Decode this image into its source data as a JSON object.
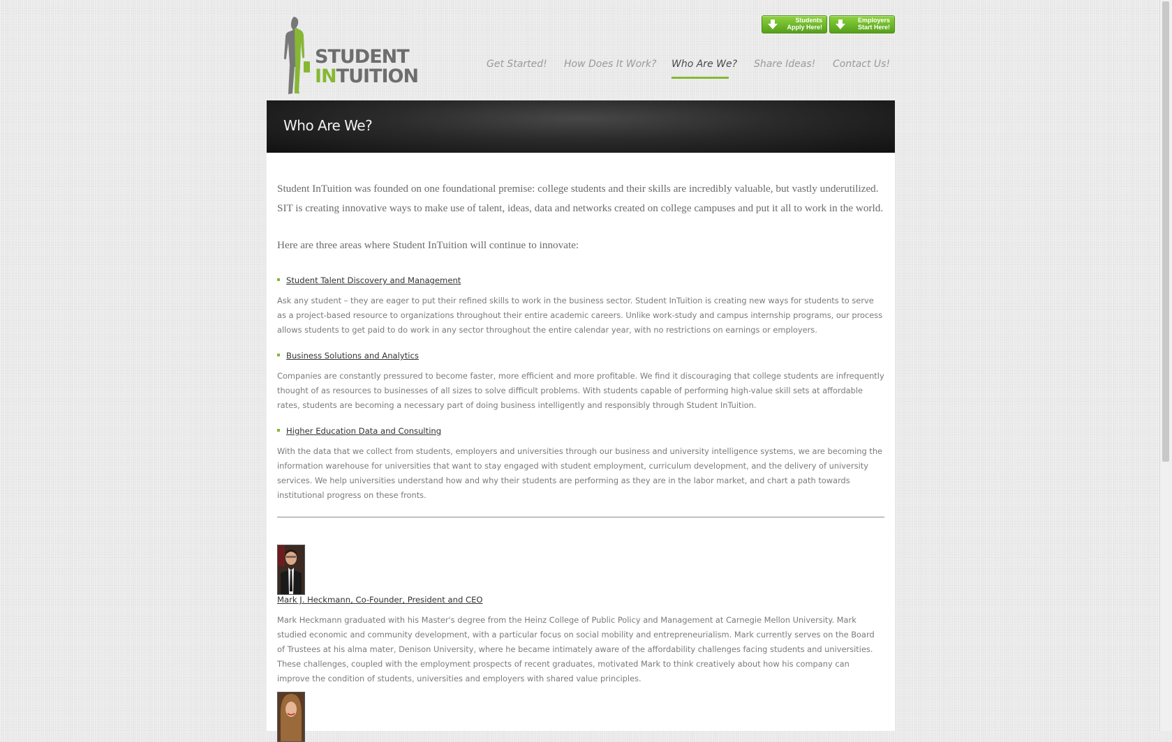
{
  "brand": {
    "wordmark_line1": "STUDENT",
    "wordmark_in": "IN",
    "wordmark_rest": "TUITION",
    "accent_color": "#86b834",
    "gray_color": "#6d6d6d"
  },
  "cta": {
    "students": {
      "line1": "Students",
      "line2": "Apply Here!",
      "icon": "down-arrow-icon"
    },
    "employers": {
      "line1": "Employers",
      "line2": "Start Here!",
      "icon": "down-arrow-icon"
    }
  },
  "nav": {
    "items": [
      {
        "label": "Get Started!"
      },
      {
        "label": "How Does It Work?"
      },
      {
        "label": "Who Are We?",
        "active": true
      },
      {
        "label": "Share Ideas!"
      },
      {
        "label": "Contact Us!"
      }
    ]
  },
  "page": {
    "title": "Who Are We?",
    "intro": "Student InTuition was founded on one foundational premise: college students and their skills are incredibly valuable, but vastly underutilized. SIT is creating innovative ways to make use of talent, ideas, data and networks created on college campuses and put it all to work in the world.",
    "lead": "Here are three areas where Student InTuition will continue to innovate:",
    "areas": [
      {
        "title": "Student Talent Discovery and Management",
        "text": "Ask any student – they are eager to put their refined skills to work in the business sector. Student InTuition is creating new ways for students to serve as a project-based resource to organizations throughout their entire academic careers. Unlike work-study and campus internship programs, our process allows students to get paid to do work in any sector throughout the entire calendar year, with no restrictions on earnings or employers."
      },
      {
        "title": "Business Solutions and Analytics",
        "text": "Companies are constantly pressured to become faster, more efficient and more profitable. We find it discouraging that college students are infrequently thought of as resources to businesses of all sizes to solve difficult problems. With students capable of performing high-value skill sets at affordable rates, students are becoming a necessary part of doing business intelligently and responsibly through Student InTuition."
      },
      {
        "title": "Higher Education Data and Consulting",
        "text": "With the data that we collect from students, employers and universities through our business and university intelligence systems, we are becoming the information warehouse for universities that want to stay engaged with student employment, curriculum development, and the delivery of university services. We help universities understand how and why their students are performing as they are in the labor market, and chart a path towards institutional progress on these fronts."
      }
    ],
    "team": [
      {
        "name": "Mark J. Heckmann, Co-Founder, President and CEO",
        "bio": "Mark Heckmann graduated with his Master's degree from the Heinz College of Public Policy and Management at Carnegie Mellon University. Mark studied economic and community development, with a particular focus on social mobility and entrepreneurialism. Mark currently serves on the Board of Trustees at his alma mater, Denison University, where he became intimately aware of the affordability challenges facing students and universities. These challenges, coupled with the employment prospects of recent graduates, motivated Mark to think creatively about how his company can improve the condition of students, universities and employers with shared value principles."
      },
      {
        "name": "",
        "bio": ""
      }
    ]
  }
}
